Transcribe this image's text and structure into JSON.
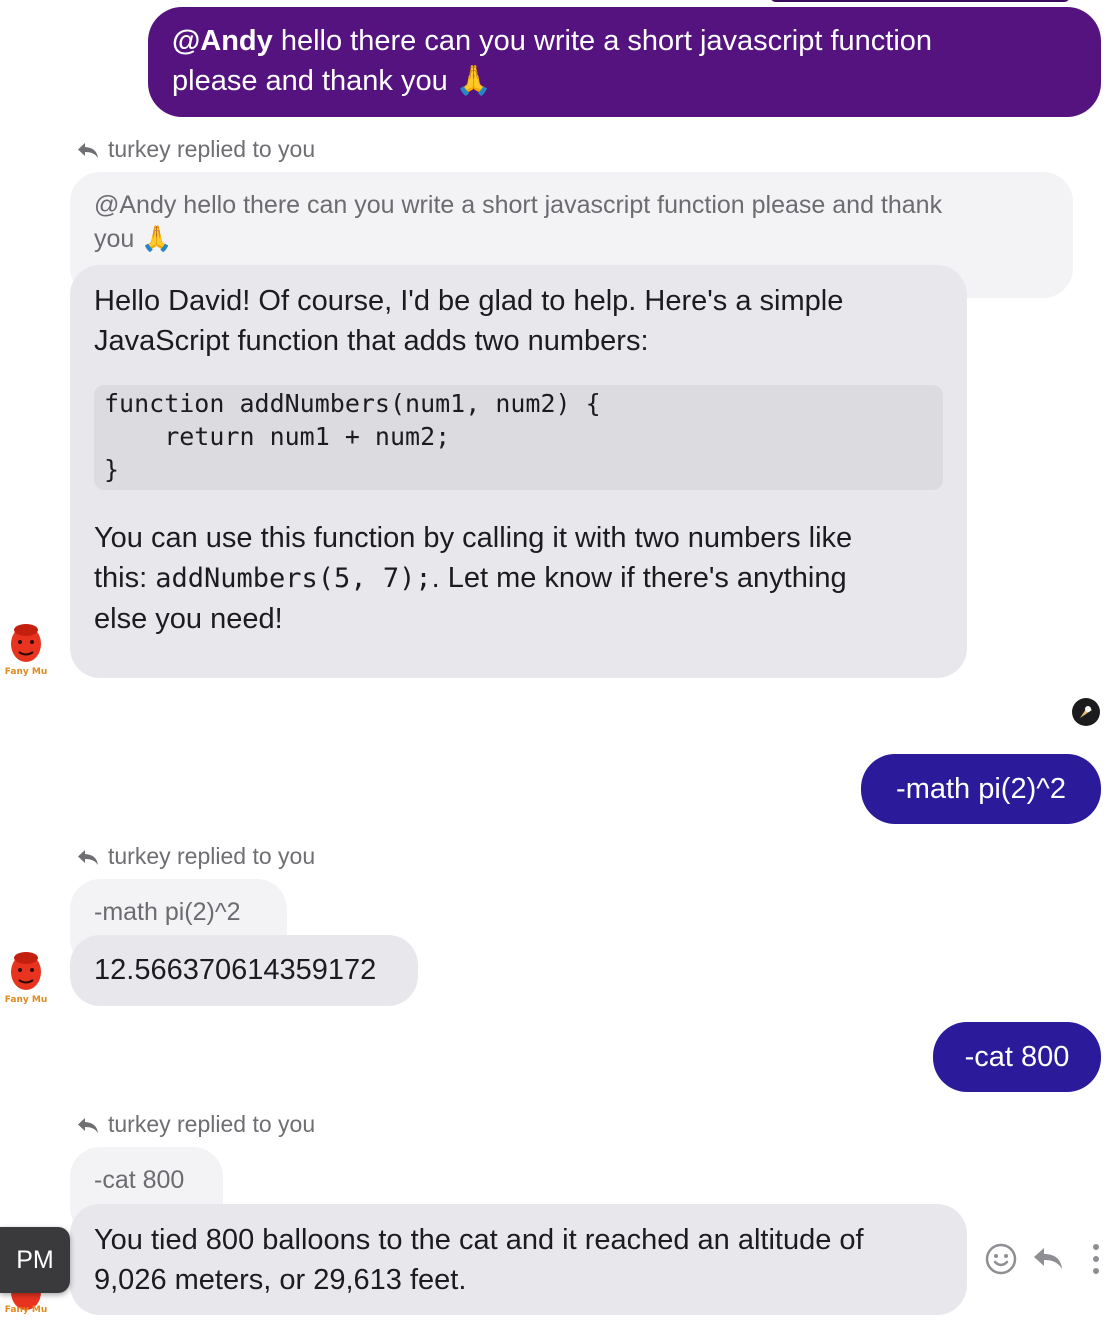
{
  "messages": {
    "m1": {
      "mention": "@Andy",
      "text_line1": " hello there can you write a short javascript function",
      "text_line2": "please and thank you 🙏"
    },
    "r1": {
      "reply_header": "turkey replied to you",
      "quote_line1": "@Andy hello there can you write a short javascript function please and thank",
      "quote_line2": "you 🙏",
      "line1": "Hello David! Of course, I'd be glad to help. Here's a simple",
      "line2": "JavaScript function that adds two numbers:",
      "code": "function addNumbers(num1, num2) {\n    return num1 + num2;\n}",
      "line3": "You can use this function by calling it with two numbers like",
      "line4_prefix": "this: ",
      "line4_code": "addNumbers(5, 7);",
      "line4_suffix": ". Let me know if there's anything",
      "line5": "else you need!"
    },
    "m2": {
      "text": "-math pi(2)^2"
    },
    "r2": {
      "reply_header": "turkey replied to you",
      "quote": "-math pi(2)^2",
      "text": "12.566370614359172"
    },
    "m3": {
      "text": "-cat 800"
    },
    "r3": {
      "reply_header": "turkey replied to you",
      "quote": "-cat 800",
      "line1": "You tied 800 balloons to the cat and it reached an altitude of",
      "line2": "9,026 meters, or 29,613 feet."
    }
  },
  "avatar_caption": "Fany Mu",
  "pm_badge": "PM",
  "colors": {
    "outgoing_purple": "#54137e",
    "outgoing_indigo": "#2b1a9a",
    "incoming_bg": "#e8e8ec",
    "quote_bg": "#f3f3f6"
  }
}
